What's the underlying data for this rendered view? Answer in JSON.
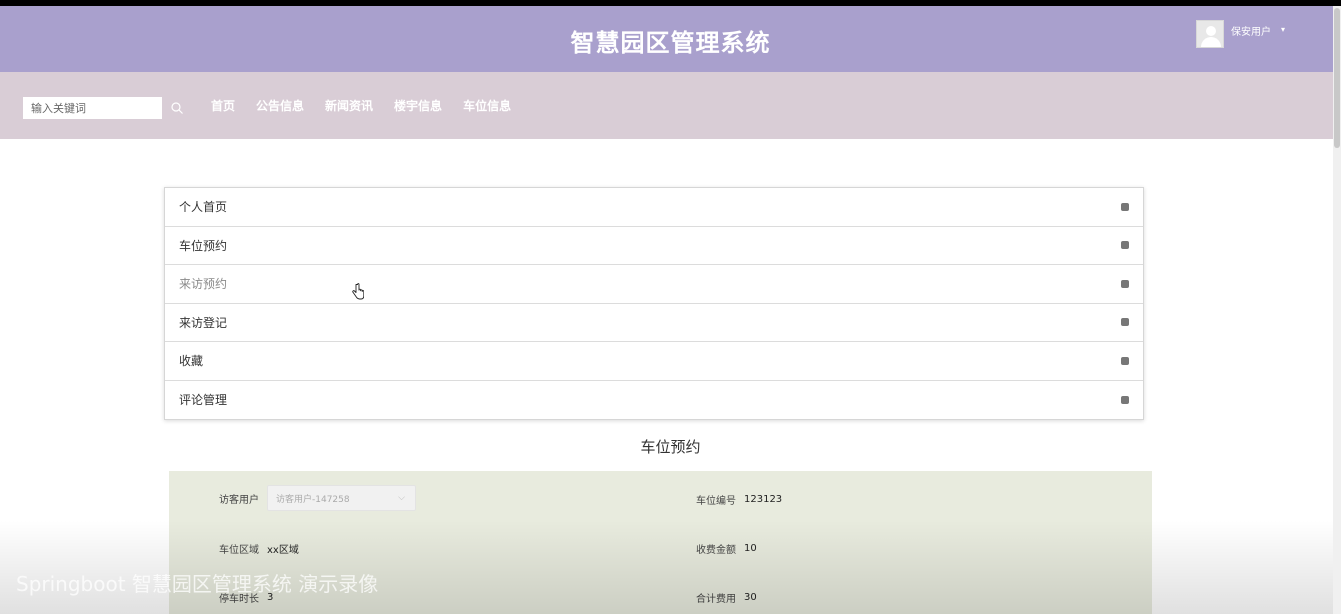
{
  "header": {
    "title": "智慧园区管理系统",
    "user": {
      "name": "保安用户",
      "caret": "▾"
    }
  },
  "navbar": {
    "search_placeholder": "输入关键词",
    "links": [
      "首页",
      "公告信息",
      "新闻资讯",
      "楼宇信息",
      "车位信息"
    ]
  },
  "menu": {
    "items": [
      "个人首页",
      "车位预约",
      "来访预约",
      "来访登记",
      "收藏",
      "评论管理"
    ]
  },
  "form": {
    "title": "车位预约",
    "visitor_user": {
      "label": "访客用户",
      "value": "访客用户-147258"
    },
    "space_number": {
      "label": "车位编号",
      "value": "123123"
    },
    "space_area": {
      "label": "车位区域",
      "value": "xx区域"
    },
    "fee_amount": {
      "label": "收费金额",
      "value": "10"
    },
    "parking_duration": {
      "label": "停车时长",
      "value": "3"
    },
    "total_fee": {
      "label": "合计费用",
      "value": "30"
    }
  },
  "watermark": "Springboot 智慧园区管理系统 演示录像",
  "colors": {
    "header_bg": "#a9a0cd",
    "navbar_bg": "#d9cdd6",
    "form_bg": "#e8ebde"
  }
}
